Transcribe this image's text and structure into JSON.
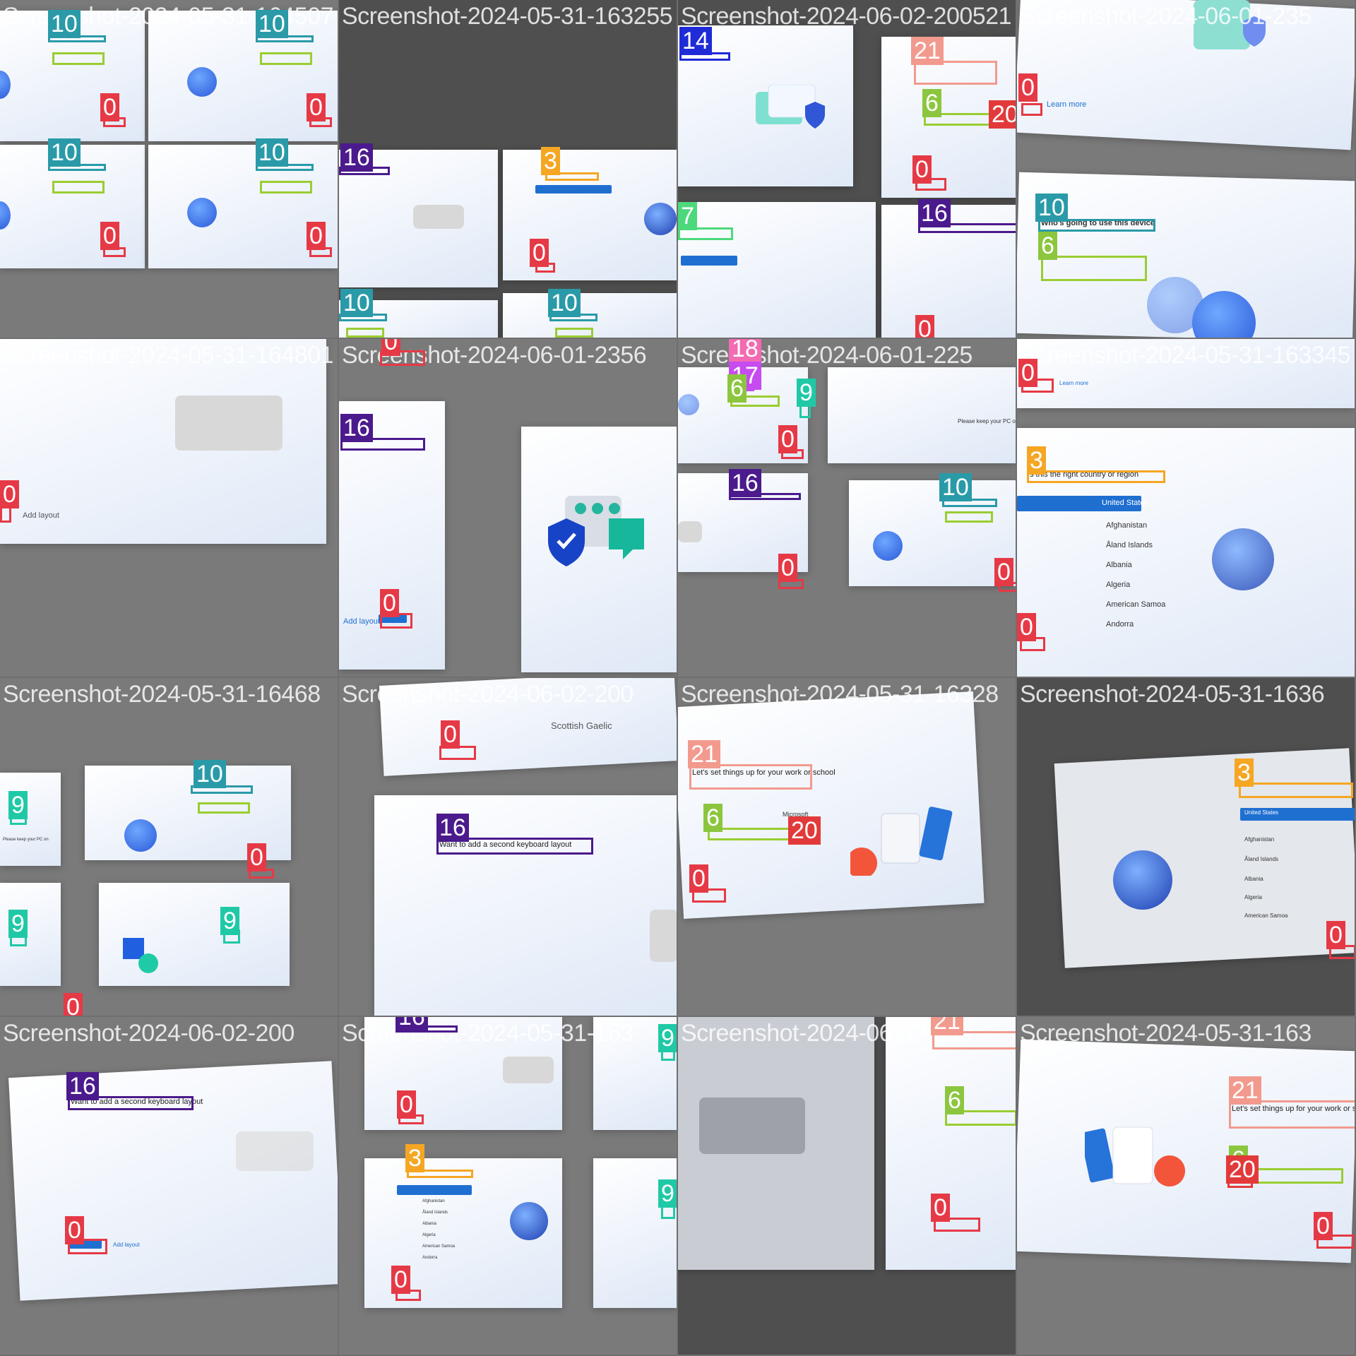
{
  "tiles": [
    {
      "title": "Screenshot-2024-05-31-164507"
    },
    {
      "title": "Screenshot-2024-05-31-163255"
    },
    {
      "title": "Screenshot-2024-06-02-200521"
    },
    {
      "title": "Screenshot-2024-06-01-235"
    },
    {
      "title": "Screenshot-2024-05-31-164801"
    },
    {
      "title": "Screenshot-2024-06-01-2356"
    },
    {
      "title": "Screenshot-2024-06-01-225"
    },
    {
      "title": "Screenshot-2024-05-31-163345"
    },
    {
      "title": "Screenshot-2024-05-31-16468"
    },
    {
      "title": "Screenshot-2024-06-02-200"
    },
    {
      "title": "Screenshot-2024-05-31-16328"
    },
    {
      "title": "Screenshot-2024-05-31-1636"
    },
    {
      "title": "Screenshot-2024-06-02-200"
    },
    {
      "title": "Screenshot-2024-05-31-163"
    }
  ],
  "labels": {
    "l0": "0",
    "l3": "3",
    "l6": "6",
    "l7": "7",
    "l9": "9",
    "l10": "10",
    "l14": "14",
    "l16": "16",
    "l17": "17",
    "l18": "18",
    "l20": "20",
    "l21": "21"
  },
  "texts": {
    "add_layout": "Add layout",
    "want_second": "Want to add a second keyboard layout",
    "whos_going": "Who's going to use this device",
    "right_country": "s this the right country or region",
    "lets_set": "Let's set things up for your work or school",
    "keep_pc": "Please keep your PC on",
    "united_states": "United States",
    "afghanistan": "Afghanistan",
    "aland": "Åland Islands",
    "albania": "Albania",
    "algeria": "Algeria",
    "american_samoa": "American Samoa",
    "andorra": "Andorra",
    "scottish_gaelic": "Scottish Gaelic",
    "microsoft": "Microsoft",
    "learn_more": "Learn more"
  }
}
